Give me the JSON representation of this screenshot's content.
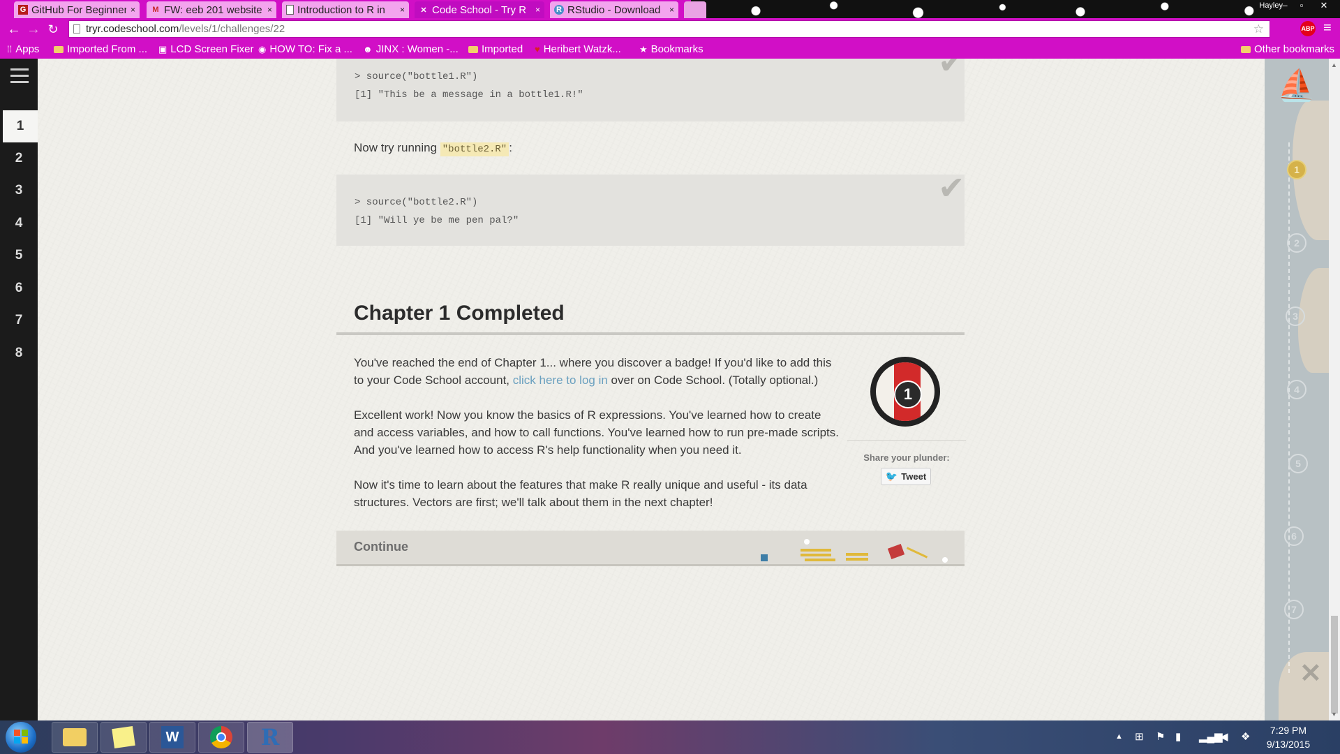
{
  "browser": {
    "tabs": [
      {
        "label": "GitHub For Beginner",
        "icon": "github-favicon",
        "active": false
      },
      {
        "label": "FW: eeb 201 website",
        "icon": "gmail-favicon",
        "active": false
      },
      {
        "label": "Introduction to R in",
        "icon": "document-favicon",
        "active": false
      },
      {
        "label": "Code School - Try R",
        "icon": "codeschool-favicon",
        "active": true
      },
      {
        "label": "RStudio - Download",
        "icon": "rstudio-favicon",
        "active": false
      }
    ],
    "tab_close": "×",
    "profile_name": "Hayley",
    "url_host": "tryr.codeschool.com",
    "url_path": "/levels/1/challenges/22",
    "abp_label": "ABP",
    "bookmarks": [
      {
        "label": "Apps",
        "icon": "apps-grid-icon"
      },
      {
        "label": "Imported From ...",
        "icon": "folder-icon"
      },
      {
        "label": "LCD Screen Fixer",
        "icon": "site-icon"
      },
      {
        "label": "HOW TO: Fix a ...",
        "icon": "site-icon"
      },
      {
        "label": "JINX : Women -...",
        "icon": "site-icon"
      },
      {
        "label": "Imported",
        "icon": "folder-icon"
      },
      {
        "label": "Heribert Watzk...",
        "icon": "site-icon"
      },
      {
        "label": "Bookmarks",
        "icon": "star-icon"
      }
    ],
    "other_bookmarks": "Other bookmarks"
  },
  "sidebar": {
    "levels": [
      "1",
      "2",
      "3",
      "4",
      "5",
      "6",
      "7",
      "8"
    ],
    "active_level": "1"
  },
  "content": {
    "code_block_1": {
      "line1": "> source(\"bottle1.R\")",
      "line2": "[1] \"This be a message in a bottle1.R!\""
    },
    "try_prefix": "Now try running ",
    "try_code": "\"bottle2.R\"",
    "try_suffix": ":",
    "code_block_2": {
      "line1": "> source(\"bottle2.R\")",
      "line2": "[1] \"Will ye be me pen pal?\""
    },
    "chapter_title": "Chapter 1 Completed",
    "para1_part1": "You've reached the end of Chapter 1... where you discover a badge! If you'd like to add this to your Code School account, ",
    "para1_link": "click here to log in",
    "para1_part2": " over on Code School. (Totally optional.)",
    "para2": "Excellent work! Now you know the basics of R expressions. You've learned how to create and access variables, and how to call functions. You've learned how to run pre-made scripts. And you've learned how to access R's help functionality when you need it.",
    "para3": "Now it's time to learn about the features that make R really unique and useful - its data structures. Vectors are first; we'll talk about them in the next chapter!",
    "badge_number": "1",
    "share_label": "Share your plunder:",
    "tweet_label": "Tweet",
    "continue_label": "Continue"
  },
  "map": {
    "waypoints": [
      "1",
      "2",
      "3",
      "4",
      "5",
      "6",
      "7"
    ],
    "completed": [
      "1"
    ]
  },
  "taskbar": {
    "apps": [
      "file-explorer-icon",
      "sticky-notes-icon",
      "word-icon",
      "chrome-icon",
      "r-icon"
    ],
    "time": "7:29 PM",
    "date": "9/13/2015"
  },
  "colors": {
    "browser_theme": "#d10fc6",
    "badge_red": "#d22a2a",
    "link": "#6aa0bf",
    "inline_code_bg": "#f5e9b5"
  }
}
